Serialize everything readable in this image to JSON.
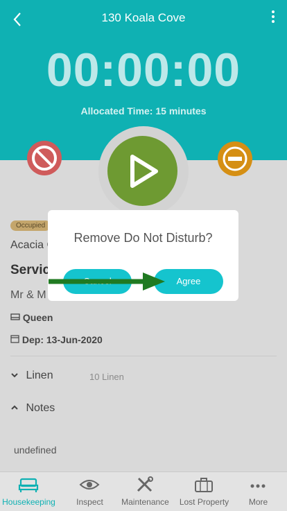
{
  "header": {
    "title": "130 Koala Cove",
    "timer": "00:00:00",
    "allocated": "Allocated Time: 15 minutes"
  },
  "room": {
    "badge": "Occupied",
    "line1": "Acacia C",
    "line2": "Servic",
    "line3": "Mr & M",
    "bed": "Queen",
    "dep": "Dep: 13-Jun-2020"
  },
  "sections": {
    "linen_label": "Linen",
    "linen_count": "10 Linen",
    "notes_label": "Notes",
    "notes_value": "undefined"
  },
  "modal": {
    "title": "Remove Do Not Disturb?",
    "cancel": "Cancel",
    "agree": "Agree"
  },
  "tabs": [
    "Housekeeping",
    "Inspect",
    "Maintenance",
    "Lost Property",
    "More"
  ],
  "colors": {
    "teal": "#0fb1b3",
    "green": "#6e9a32",
    "dnd_red": "#cf5b5b",
    "orange": "#d58f14",
    "button": "#15c4ce"
  }
}
